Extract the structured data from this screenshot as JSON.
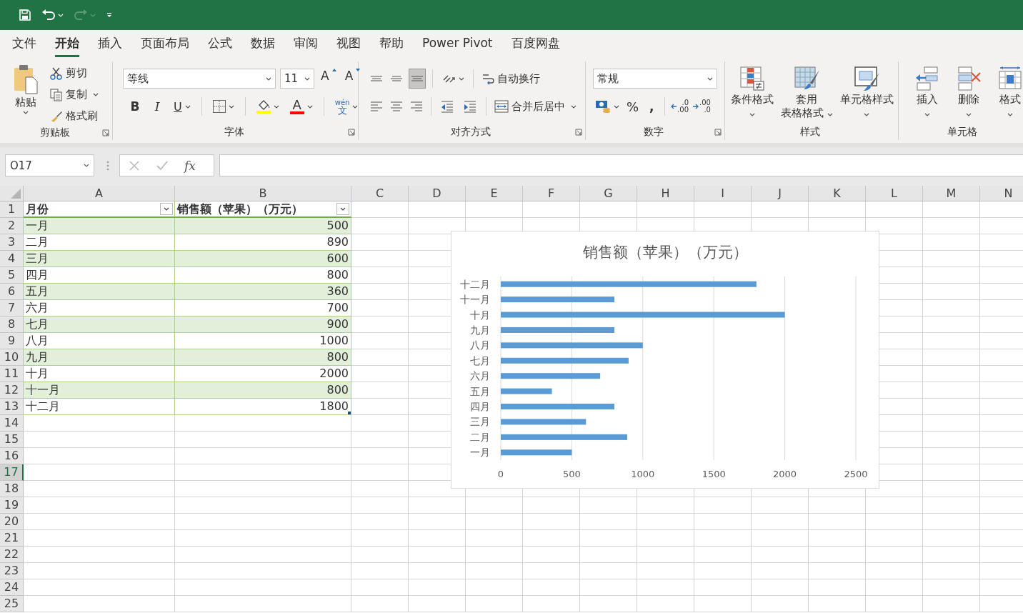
{
  "quick_access": [
    {
      "kind": "save",
      "disabled": false
    },
    {
      "kind": "undo",
      "disabled": false
    },
    {
      "kind": "redo",
      "disabled": true
    },
    {
      "kind": "customize",
      "disabled": false
    }
  ],
  "menu_tabs": [
    {
      "label": "文件",
      "selected": false
    },
    {
      "label": "开始",
      "selected": true
    },
    {
      "label": "插入",
      "selected": false
    },
    {
      "label": "页面布局",
      "selected": false
    },
    {
      "label": "公式",
      "selected": false
    },
    {
      "label": "数据",
      "selected": false
    },
    {
      "label": "审阅",
      "selected": false
    },
    {
      "label": "视图",
      "selected": false
    },
    {
      "label": "帮助",
      "selected": false
    },
    {
      "label": "Power Pivot",
      "selected": false
    },
    {
      "label": "百度网盘",
      "selected": false
    }
  ],
  "ribbon": {
    "groups": [
      {
        "kind": "clipboard",
        "title": "剪贴板",
        "has_launcher": true,
        "paste": "粘贴",
        "items": [
          {
            "kind": "cut",
            "label": "剪切",
            "dropdown": false
          },
          {
            "kind": "copy",
            "label": "复制",
            "dropdown": true
          },
          {
            "kind": "painter",
            "label": "格式刷",
            "dropdown": false
          }
        ]
      },
      {
        "kind": "font",
        "title": "字体",
        "has_launcher": true,
        "font_name": "等线",
        "font_size": "11",
        "grow": "A",
        "shrink": "A",
        "bold": "B",
        "italic": "I",
        "underline": "U",
        "font_color": "A",
        "phonetic": [
          "wén",
          "文"
        ]
      },
      {
        "kind": "alignment",
        "title": "对齐方式",
        "has_launcher": true,
        "vertical": [
          {
            "kind": "top",
            "selected": false
          },
          {
            "kind": "middle",
            "selected": false
          },
          {
            "kind": "bottom",
            "selected": true
          }
        ],
        "horizontal": [
          {
            "kind": "left",
            "selected": false
          },
          {
            "kind": "center",
            "selected": false
          },
          {
            "kind": "right",
            "selected": false
          }
        ],
        "wrap_text": "自动换行",
        "merge_center": "合并后居中"
      },
      {
        "kind": "number",
        "title": "数字",
        "has_launcher": true,
        "format": "常规",
        "percent": "%",
        "comma": ",",
        "increase_decimal": [
          ".0",
          ".00"
        ],
        "decrease_decimal": [
          ".00",
          ".0"
        ]
      },
      {
        "kind": "styles",
        "title": "样式",
        "has_launcher": false,
        "buttons": [
          {
            "kind": "conditional",
            "lines": [
              "条件格式"
            ]
          },
          {
            "kind": "table",
            "lines": [
              "套用",
              "表格格式"
            ]
          },
          {
            "kind": "cellstyle",
            "lines": [
              "单元格样式"
            ]
          }
        ]
      },
      {
        "kind": "cells",
        "title": "单元格",
        "has_launcher": false,
        "buttons": [
          {
            "kind": "insert",
            "lines": [
              "插入"
            ]
          },
          {
            "kind": "delete",
            "lines": [
              "删除"
            ]
          },
          {
            "kind": "format",
            "lines": [
              "格式"
            ]
          }
        ]
      }
    ]
  },
  "formula_bar": {
    "name_box": "O17",
    "function_label": "fx"
  },
  "sheet": {
    "columns": [
      {
        "label": "A",
        "selected": false
      },
      {
        "label": "B",
        "selected": false
      },
      {
        "label": "C",
        "selected": false
      },
      {
        "label": "D",
        "selected": false
      },
      {
        "label": "E",
        "selected": false
      },
      {
        "label": "F",
        "selected": false
      },
      {
        "label": "G",
        "selected": false
      },
      {
        "label": "H",
        "selected": false
      },
      {
        "label": "I",
        "selected": false
      },
      {
        "label": "J",
        "selected": false
      },
      {
        "label": "K",
        "selected": false
      },
      {
        "label": "L",
        "selected": false
      },
      {
        "label": "M",
        "selected": false
      },
      {
        "label": "N",
        "selected": false
      }
    ],
    "rows": [
      {
        "label": "1",
        "selected": false
      },
      {
        "label": "2",
        "selected": false
      },
      {
        "label": "3",
        "selected": false
      },
      {
        "label": "4",
        "selected": false
      },
      {
        "label": "5",
        "selected": false
      },
      {
        "label": "6",
        "selected": false
      },
      {
        "label": "7",
        "selected": false
      },
      {
        "label": "8",
        "selected": false
      },
      {
        "label": "9",
        "selected": false
      },
      {
        "label": "10",
        "selected": false
      },
      {
        "label": "11",
        "selected": false
      },
      {
        "label": "12",
        "selected": false
      },
      {
        "label": "13",
        "selected": false
      },
      {
        "label": "14",
        "selected": false
      },
      {
        "label": "15",
        "selected": false
      },
      {
        "label": "16",
        "selected": false
      },
      {
        "label": "17",
        "selected": true
      },
      {
        "label": "18",
        "selected": false
      },
      {
        "label": "19",
        "selected": false
      },
      {
        "label": "20",
        "selected": false
      },
      {
        "label": "21",
        "selected": false
      },
      {
        "label": "22",
        "selected": false
      },
      {
        "label": "23",
        "selected": false
      },
      {
        "label": "24",
        "selected": false
      },
      {
        "label": "25",
        "selected": false
      }
    ],
    "table": {
      "headers": [
        "月份",
        "销售额（苹果）（万元）"
      ],
      "rows": [
        [
          "一月",
          "500"
        ],
        [
          "二月",
          "890"
        ],
        [
          "三月",
          "600"
        ],
        [
          "四月",
          "800"
        ],
        [
          "五月",
          "360"
        ],
        [
          "六月",
          "700"
        ],
        [
          "七月",
          "900"
        ],
        [
          "八月",
          "1000"
        ],
        [
          "九月",
          "800"
        ],
        [
          "十月",
          "2000"
        ],
        [
          "十一月",
          "800"
        ],
        [
          "十二月",
          "1800"
        ]
      ]
    },
    "chart": {
      "chart_data": {
        "type": "bar",
        "orientation": "horizontal",
        "title": "销售额（苹果）（万元）",
        "categories": [
          "十二月",
          "十一月",
          "十月",
          "九月",
          "八月",
          "七月",
          "六月",
          "五月",
          "四月",
          "三月",
          "二月",
          "一月"
        ],
        "series": [
          {
            "color": "#5b9bd5",
            "values": [
              1800,
              800,
              2000,
              800,
              1000,
              900,
              700,
              360,
              800,
              600,
              890,
              500
            ]
          }
        ],
        "xlim": [
          0,
          2500
        ],
        "xticks": [
          0,
          500,
          1000,
          1500,
          2000,
          2500
        ],
        "grid": true
      }
    }
  }
}
